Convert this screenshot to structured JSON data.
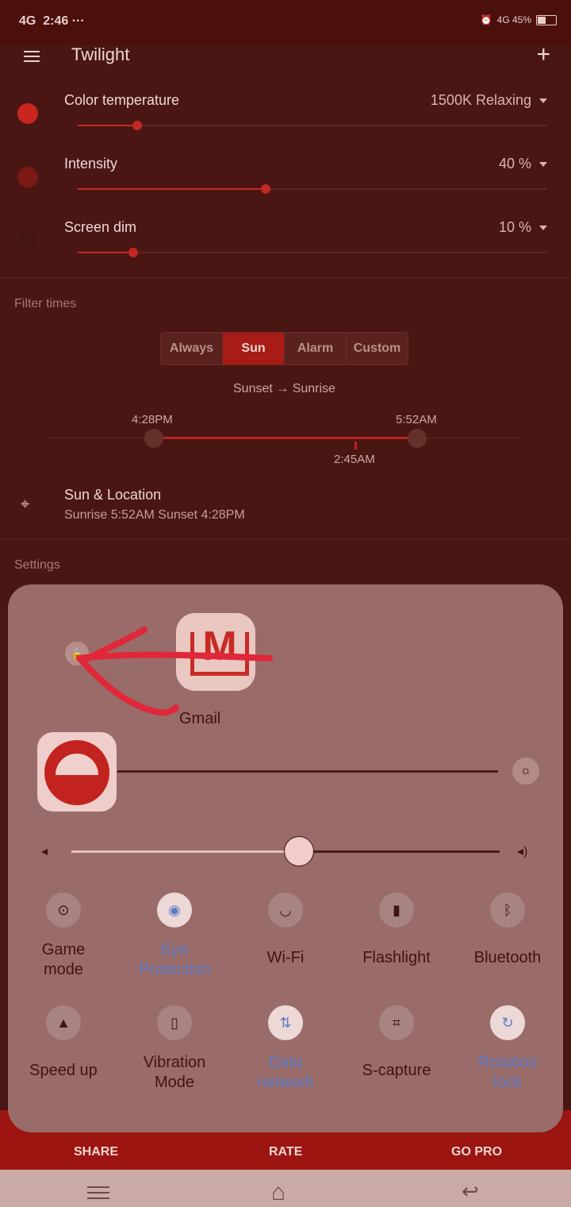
{
  "status_bar": {
    "network": "4G",
    "time": "2:46",
    "more": "···",
    "right": "4G 45%"
  },
  "app": {
    "title": "Twilight",
    "add": "+"
  },
  "filters": [
    {
      "label": "Color temperature",
      "value": "1500K Relaxing",
      "color": "#c8261f",
      "level": 0.13
    },
    {
      "label": "Intensity",
      "value": "40 %",
      "color": "#7b1a14",
      "level": 0.4
    },
    {
      "label": "Screen dim",
      "value": "10 %",
      "color": "#4a1614",
      "level": 0.12
    }
  ],
  "filter_times": {
    "heading": "Filter times",
    "options": [
      "Always",
      "Sun",
      "Alarm",
      "Custom"
    ],
    "selected": "Sun",
    "range": "Sunset → Sunrise",
    "start": "4:28PM",
    "end": "5:52AM",
    "now": "2:45AM"
  },
  "location": {
    "title": "Sun & Location",
    "subtitle": "Sunrise 5:52AM Sunset 4:28PM"
  },
  "settings_heading": "Settings",
  "quick_panel": {
    "app_label": "Gmail",
    "volume_level": 0.53,
    "tiles": [
      {
        "label": "Game mode",
        "icon": "gamepad-icon",
        "glyph": "⊙",
        "active": false
      },
      {
        "label": "Eye Protection",
        "icon": "eye-icon",
        "glyph": "◉",
        "active": true
      },
      {
        "label": "Wi-Fi",
        "icon": "wifi-icon",
        "glyph": "◡",
        "active": false
      },
      {
        "label": "Flashlight",
        "icon": "flashlight-icon",
        "glyph": "▮",
        "active": false
      },
      {
        "label": "Bluetooth",
        "icon": "bluetooth-icon",
        "glyph": "ᛒ",
        "active": false
      },
      {
        "label": "Speed up",
        "icon": "rocket-icon",
        "glyph": "▲",
        "active": false
      },
      {
        "label": "Vibration Mode",
        "icon": "vibration-icon",
        "glyph": "▯",
        "active": false
      },
      {
        "label": "Data network",
        "icon": "data-icon",
        "glyph": "⇅",
        "active": true
      },
      {
        "label": "S-capture",
        "icon": "screenshot-icon",
        "glyph": "⌗",
        "active": false
      },
      {
        "label": "Rotation lock",
        "icon": "rotation-lock-icon",
        "glyph": "↻",
        "active": true
      }
    ]
  },
  "bottom_actions": [
    "SHARE",
    "RATE",
    "GO PRO"
  ]
}
